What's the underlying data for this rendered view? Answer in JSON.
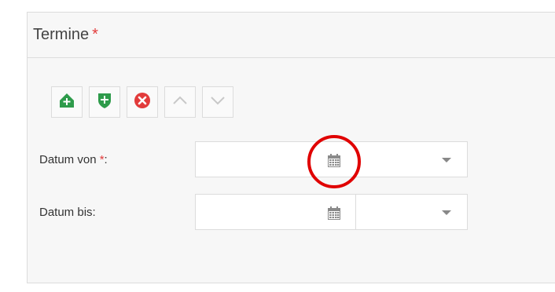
{
  "panel": {
    "title": "Termine",
    "required_mark": "*"
  },
  "toolbar": {
    "buttons": [
      {
        "icon": "add-circle-icon",
        "color": "#2e9b4b"
      },
      {
        "icon": "shield-add-icon",
        "color": "#2e9b4b"
      },
      {
        "icon": "delete-circle-icon",
        "color": "#e23b3b"
      },
      {
        "icon": "chevron-up-icon",
        "color": "#c8c8c8"
      },
      {
        "icon": "chevron-down-icon",
        "color": "#c8c8c8"
      }
    ]
  },
  "fields": {
    "datum_von": {
      "label": "Datum von ",
      "required_mark": "*",
      "colon": ":",
      "date_value": "",
      "time_value": ""
    },
    "datum_bis": {
      "label": "Datum bis:",
      "date_value": "",
      "time_value": ""
    }
  },
  "colors": {
    "accent_required": "#e23b3b",
    "highlight_ring": "#e00000"
  }
}
